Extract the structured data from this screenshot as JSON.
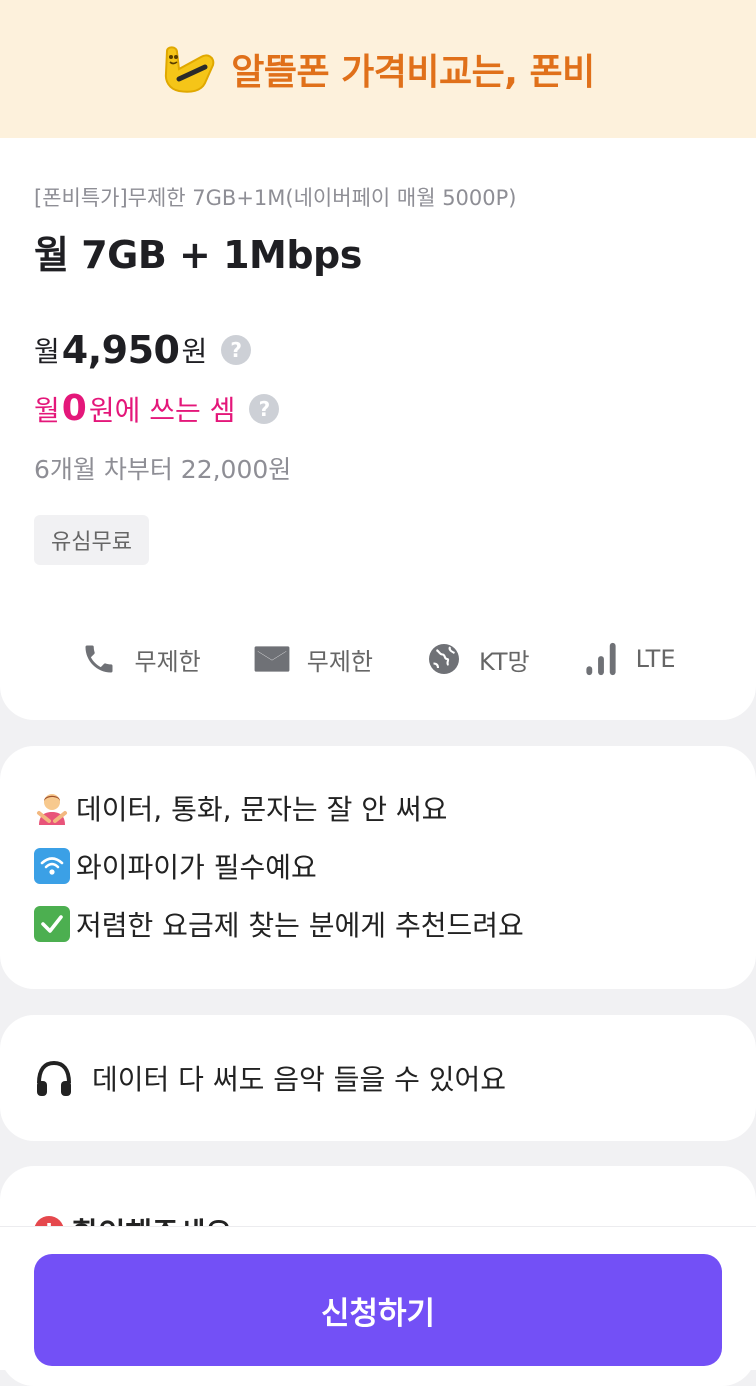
{
  "banner": {
    "text": "알뜰폰 가격비교는, 폰비",
    "logo_icon": "phonebee-logo-icon",
    "accent": "#e0701a"
  },
  "plan": {
    "subtitle": "[폰비특가]무제한 7GB+1M(네이버페이 매월 5000P)",
    "title": "월 7GB + 1Mbps",
    "price": {
      "prefix": "월",
      "amount": "4,950",
      "suffix": "원"
    },
    "effective": {
      "prefix": "월",
      "amount": "0",
      "suffix": "원에 쓰는 셈",
      "color": "#e4177a"
    },
    "after": "6개월 차부터 22,000원",
    "tag": "유심무료"
  },
  "specs": [
    {
      "icon": "phone-icon",
      "label": "무제한"
    },
    {
      "icon": "mail-icon",
      "label": "무제한"
    },
    {
      "icon": "globe-icon",
      "label": "KT망"
    },
    {
      "icon": "signal-icon",
      "label": "LTE"
    }
  ],
  "recommendations": [
    {
      "icon": "person-gesturing-no-icon",
      "text": "데이터, 통화, 문자는 잘 안 써요"
    },
    {
      "icon": "wifi-icon",
      "text": "와이파이가 필수예요"
    },
    {
      "icon": "check-mark-icon",
      "text": "저렴한 요금제 찾는 분에게 추천드려요"
    }
  ],
  "music": {
    "icon": "headphones-icon",
    "text": "데이터 다 써도 음악 들을 수 있어요"
  },
  "notice": {
    "icon": "alert-icon",
    "title": "확인해주세요"
  },
  "apply": {
    "label": "신청하기",
    "color": "#7350f6"
  },
  "help_symbol": "?",
  "alert_symbol": "!"
}
